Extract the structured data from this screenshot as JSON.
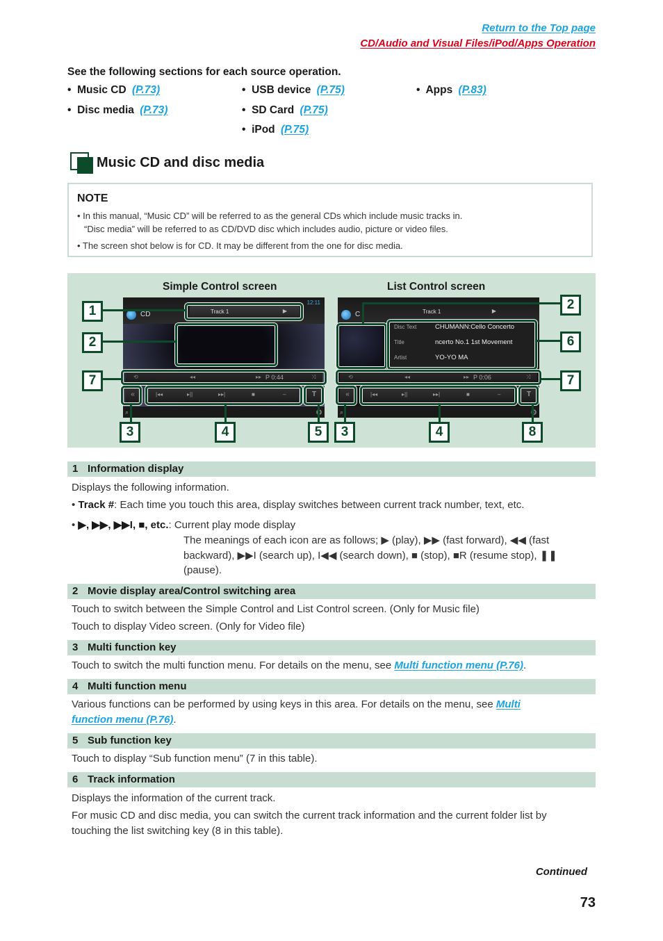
{
  "header": {
    "top_link": "Return to the Top page",
    "section_link": "CD/Audio and Visual Files/iPod/Apps Operation",
    "colors": {
      "top_link": "#1aa3e0",
      "section_link": "#e0001a"
    }
  },
  "intro": {
    "text": "See the following sections for each source operation.",
    "sources": [
      {
        "label": "Music CD",
        "ref": "(P.73)"
      },
      {
        "label": "Disc media",
        "ref": "(P.73)"
      },
      {
        "label": "USB device",
        "ref": "(P.75)"
      },
      {
        "label": "SD Card",
        "ref": "(P.75)"
      },
      {
        "label": "iPod",
        "ref": "(P.75)"
      },
      {
        "label": "Apps",
        "ref": "(P.83)"
      }
    ],
    "bullet": "•"
  },
  "section": {
    "title": "Music CD and disc media",
    "icon": "section-square-icon",
    "accent": "#0d4a2a"
  },
  "note": {
    "title": "NOTE",
    "lines": [
      "•  In this manual, “Music CD” will be referred to as the general CDs which include music tracks in.",
      "“Disc media” will be referred to as CD/DVD disc which includes audio, picture or video files.",
      "•  The screen shot below is for CD. It may be different from the one for disc media."
    ]
  },
  "screenshots": {
    "simple": {
      "label": "Simple Control screen",
      "clock": "12:11",
      "source": "CD",
      "track": "Track  1",
      "play_icon": "▶",
      "time": "P 0:44",
      "ctrl": {
        "repeat": "⟲",
        "rew": "◂◂",
        "ff": "▸▸",
        "shuffle": "⤨"
      },
      "buttons": [
        "|◂◂",
        "▸||",
        "▸▸|",
        "■",
        "–"
      ],
      "multi_key": "«",
      "sub_key": "T",
      "callouts": [
        "1",
        "2",
        "7",
        "3",
        "4",
        "5"
      ]
    },
    "list": {
      "label": "List Control screen",
      "source": "C",
      "track": "Track  1",
      "play_icon": "▶",
      "time": "P 0:06",
      "ctrl": {
        "repeat": "⟲",
        "rew": "◂◂",
        "ff": "▸▸",
        "shuffle": "⤨"
      },
      "buttons": [
        "|◂◂",
        "▸||",
        "▸▸|",
        "■",
        "–"
      ],
      "multi_key": "«",
      "list_key": "T",
      "info": [
        {
          "label": "Disc Text",
          "value": "CHUMANN:Cello Concerto"
        },
        {
          "label": "Title",
          "value": "ncerto No.1 1st Movement"
        },
        {
          "label": "Artist",
          "value": "YO-YO MA"
        }
      ],
      "callouts": [
        "2",
        "6",
        "7",
        "3",
        "4",
        "8"
      ]
    }
  },
  "table": {
    "rows": [
      {
        "num": "1",
        "title": "Information display"
      },
      {
        "num": "2",
        "title": "Movie display area/Control switching area"
      },
      {
        "num": "3",
        "title": "Multi function key"
      },
      {
        "num": "4",
        "title": "Multi function menu"
      },
      {
        "num": "5",
        "title": "Sub function key"
      },
      {
        "num": "6",
        "title": "Track information"
      }
    ],
    "r1": {
      "l1": "Displays the following information.",
      "track_key": "Track #",
      "track_desc": ": Each time you touch this area, display switches between current track number, text, etc.",
      "icons_key": "▶, ▶▶, ▶▶I, ■, etc.",
      "icons_desc": ": Current play mode display",
      "m1": "The meanings of each icon are as follows; ▶ (play), ▶▶ (fast forward), ◀◀ (fast",
      "m2": "backward), ▶▶I (search up), I◀◀ (search down), ■ (stop), ■R (resume stop), ❚❚",
      "m3": "(pause)."
    },
    "r2": {
      "l1": "Touch to switch between the Simple Control and List Control screen. (Only for Music file)",
      "l2": "Touch to display Video screen. (Only for Video file)"
    },
    "r3": {
      "pre": "Touch to switch the multi function menu. For details on the menu, see ",
      "link": "Multi function menu (P.76)",
      "post": "."
    },
    "r4": {
      "pre": "Various functions can be performed by using keys in this area. For details on the menu, see ",
      "link1": "Multi",
      "link2": "function menu (P.76)",
      "post": "."
    },
    "r5": {
      "l1": "Touch to display “Sub function menu” (7 in this table)."
    },
    "r6": {
      "l1": "Displays the information of the current track.",
      "l2": "For music CD and disc media, you can switch the current track information and the current folder list by",
      "l3": "touching the list switching key (8 in this table)."
    }
  },
  "footer": {
    "continued": "Continued",
    "page": "73"
  }
}
